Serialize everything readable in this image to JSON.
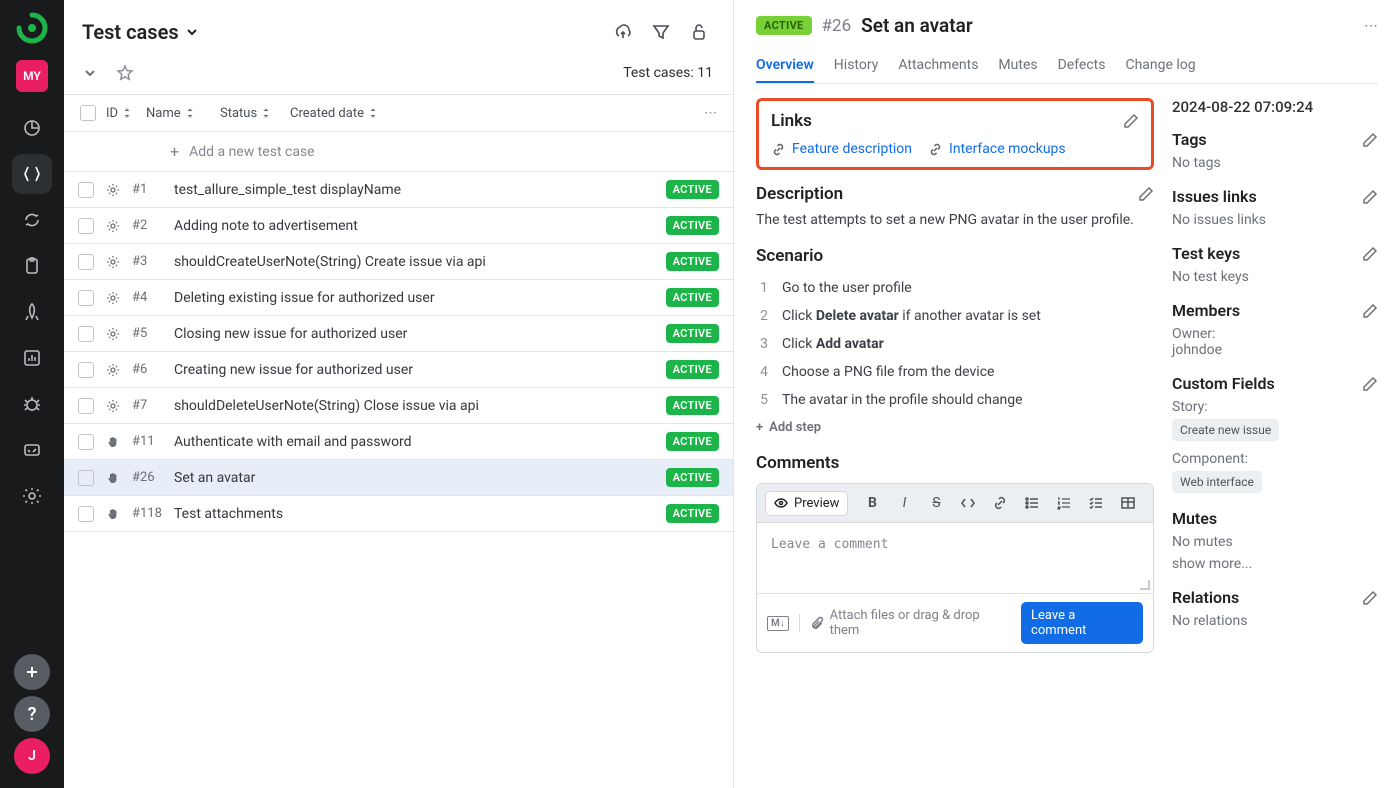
{
  "sidebar": {
    "my": "MY",
    "user_letter": "J"
  },
  "list": {
    "title": "Test cases",
    "count_label": "Test cases: 11",
    "columns": {
      "id": "ID",
      "name": "Name",
      "status": "Status",
      "created": "Created date"
    },
    "add_row": "Add a new test case",
    "rows": [
      {
        "id": "#1",
        "name": "test_allure_simple_test displayName",
        "status": "ACTIVE",
        "type": "auto"
      },
      {
        "id": "#2",
        "name": "Adding note to advertisement",
        "status": "ACTIVE",
        "type": "auto"
      },
      {
        "id": "#3",
        "name": "shouldCreateUserNote(String) Create issue via api",
        "status": "ACTIVE",
        "type": "auto"
      },
      {
        "id": "#4",
        "name": "Deleting existing issue for authorized user",
        "status": "ACTIVE",
        "type": "auto"
      },
      {
        "id": "#5",
        "name": "Closing new issue for authorized user",
        "status": "ACTIVE",
        "type": "auto"
      },
      {
        "id": "#6",
        "name": "Creating new issue for authorized user",
        "status": "ACTIVE",
        "type": "auto"
      },
      {
        "id": "#7",
        "name": "shouldDeleteUserNote(String) Close issue via api",
        "status": "ACTIVE",
        "type": "auto"
      },
      {
        "id": "#11",
        "name": "Authenticate with email and password",
        "status": "ACTIVE",
        "type": "manual"
      },
      {
        "id": "#26",
        "name": "Set an avatar",
        "status": "ACTIVE",
        "type": "manual",
        "selected": true
      },
      {
        "id": "#118",
        "name": "Test attachments",
        "status": "ACTIVE",
        "type": "manual"
      }
    ]
  },
  "detail": {
    "badge": "ACTIVE",
    "id": "#26",
    "name": "Set an avatar",
    "tabs": [
      "Overview",
      "History",
      "Attachments",
      "Mutes",
      "Defects",
      "Change log"
    ],
    "links": {
      "title": "Links",
      "items": [
        "Feature description",
        "Interface mockups"
      ]
    },
    "description": {
      "title": "Description",
      "text": "The test attempts to set a new PNG avatar in the user profile."
    },
    "scenario": {
      "title": "Scenario",
      "steps": [
        "Go to the user profile",
        "Click <b>Delete avatar</b> if another avatar is set",
        "Click <b>Add avatar</b>",
        "Choose a PNG file from the device",
        "The avatar in the profile should change"
      ],
      "add_step": "Add step"
    },
    "comments": {
      "title": "Comments",
      "preview": "Preview",
      "placeholder": "Leave a comment",
      "attach_hint": "Attach files or drag & drop them",
      "submit": "Leave a comment"
    },
    "meta": {
      "date": "2024-08-22 07:09:24",
      "tags": {
        "label": "Tags",
        "value": "No tags"
      },
      "issues": {
        "label": "Issues links",
        "value": "No issues links"
      },
      "testkeys": {
        "label": "Test keys",
        "value": "No test keys"
      },
      "members": {
        "label": "Members",
        "owner_label": "Owner:",
        "owner": "johndoe"
      },
      "custom": {
        "label": "Custom Fields",
        "story_label": "Story:",
        "story_tag": "Create new issue",
        "component_label": "Component:",
        "component_tag": "Web interface"
      },
      "mutes": {
        "label": "Mutes",
        "value": "No mutes",
        "show_more": "show more..."
      },
      "relations": {
        "label": "Relations",
        "value": "No relations"
      }
    }
  }
}
